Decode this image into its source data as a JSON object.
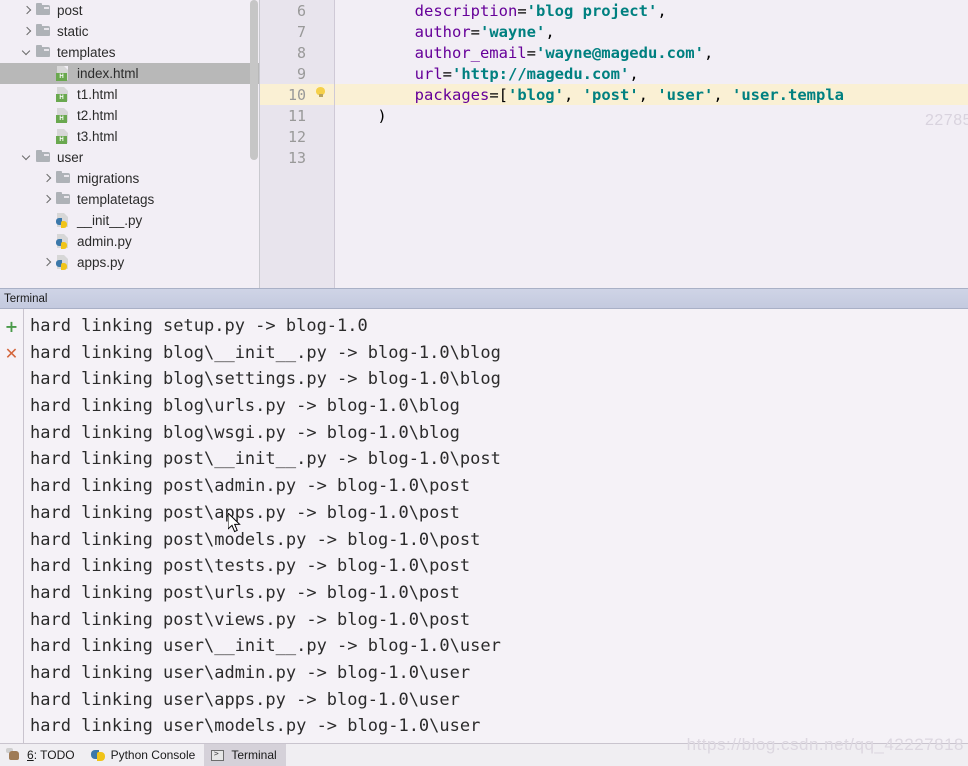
{
  "project_tree": {
    "items": [
      {
        "label": "post",
        "icon": "folder-icon",
        "indent": 1,
        "arrow": "right",
        "selected": false
      },
      {
        "label": "static",
        "icon": "folder-icon",
        "indent": 1,
        "arrow": "right",
        "selected": false
      },
      {
        "label": "templates",
        "icon": "folder-icon",
        "indent": 1,
        "arrow": "down",
        "selected": false
      },
      {
        "label": "index.html",
        "icon": "html-file-icon",
        "indent": 2,
        "arrow": "none",
        "selected": true
      },
      {
        "label": "t1.html",
        "icon": "html-file-icon",
        "indent": 2,
        "arrow": "none",
        "selected": false
      },
      {
        "label": "t2.html",
        "icon": "html-file-icon",
        "indent": 2,
        "arrow": "none",
        "selected": false
      },
      {
        "label": "t3.html",
        "icon": "html-file-icon",
        "indent": 2,
        "arrow": "none",
        "selected": false
      },
      {
        "label": "user",
        "icon": "folder-icon",
        "indent": 1,
        "arrow": "down",
        "selected": false
      },
      {
        "label": "migrations",
        "icon": "folder-icon",
        "indent": 2,
        "arrow": "right",
        "selected": false
      },
      {
        "label": "templatetags",
        "icon": "folder-icon",
        "indent": 2,
        "arrow": "right",
        "selected": false
      },
      {
        "label": "__init__.py",
        "icon": "python-file-icon",
        "indent": 2,
        "arrow": "none",
        "selected": false
      },
      {
        "label": "admin.py",
        "icon": "python-file-icon",
        "indent": 2,
        "arrow": "none",
        "selected": false
      },
      {
        "label": "apps.py",
        "icon": "python-file-icon",
        "indent": 2,
        "arrow": "right",
        "selected": false
      }
    ]
  },
  "editor": {
    "lines": [
      {
        "number": "6",
        "bulb": false,
        "current": false,
        "tokens": [
          {
            "t": "plain",
            "v": "        "
          },
          {
            "t": "param",
            "v": "description"
          },
          {
            "t": "punct",
            "v": "="
          },
          {
            "t": "str",
            "v": "'blog project'"
          },
          {
            "t": "punct",
            "v": ","
          }
        ]
      },
      {
        "number": "7",
        "bulb": false,
        "current": false,
        "tokens": [
          {
            "t": "plain",
            "v": "        "
          },
          {
            "t": "param",
            "v": "author"
          },
          {
            "t": "punct",
            "v": "="
          },
          {
            "t": "str",
            "v": "'wayne'"
          },
          {
            "t": "punct",
            "v": ","
          }
        ]
      },
      {
        "number": "8",
        "bulb": false,
        "current": false,
        "tokens": [
          {
            "t": "plain",
            "v": "        "
          },
          {
            "t": "param",
            "v": "author_email"
          },
          {
            "t": "punct",
            "v": "="
          },
          {
            "t": "str",
            "v": "'wayne@magedu.com'"
          },
          {
            "t": "punct",
            "v": ","
          }
        ]
      },
      {
        "number": "9",
        "bulb": false,
        "current": false,
        "tokens": [
          {
            "t": "plain",
            "v": "        "
          },
          {
            "t": "param",
            "v": "url"
          },
          {
            "t": "punct",
            "v": "="
          },
          {
            "t": "str",
            "v": "'http://magedu.com'"
          },
          {
            "t": "punct",
            "v": ","
          }
        ]
      },
      {
        "number": "10",
        "bulb": true,
        "current": true,
        "tokens": [
          {
            "t": "plain",
            "v": "        "
          },
          {
            "t": "param",
            "v": "packages"
          },
          {
            "t": "punct",
            "v": "=["
          },
          {
            "t": "str",
            "v": "'blog'"
          },
          {
            "t": "punct",
            "v": ", "
          },
          {
            "t": "str",
            "v": "'post'"
          },
          {
            "t": "punct",
            "v": ", "
          },
          {
            "t": "str",
            "v": "'user'"
          },
          {
            "t": "punct",
            "v": ", "
          },
          {
            "t": "str",
            "v": "'user.templa"
          }
        ]
      },
      {
        "number": "11",
        "bulb": false,
        "current": false,
        "tokens": [
          {
            "t": "punct",
            "v": "    )"
          }
        ]
      },
      {
        "number": "12",
        "bulb": false,
        "current": false,
        "tokens": []
      },
      {
        "number": "13",
        "bulb": false,
        "current": false,
        "tokens": []
      }
    ],
    "watermark": "22785"
  },
  "terminal": {
    "header_title": "Terminal",
    "gutter_icons": [
      {
        "name": "add-icon",
        "glyph": "+"
      },
      {
        "name": "close-icon",
        "glyph": "✕"
      }
    ],
    "lines": [
      "hard linking setup.py -> blog-1.0",
      "hard linking blog\\__init__.py -> blog-1.0\\blog",
      "hard linking blog\\settings.py -> blog-1.0\\blog",
      "hard linking blog\\urls.py -> blog-1.0\\blog",
      "hard linking blog\\wsgi.py -> blog-1.0\\blog",
      "hard linking post\\__init__.py -> blog-1.0\\post",
      "hard linking post\\admin.py -> blog-1.0\\post",
      "hard linking post\\apps.py -> blog-1.0\\post",
      "hard linking post\\models.py -> blog-1.0\\post",
      "hard linking post\\tests.py -> blog-1.0\\post",
      "hard linking post\\urls.py -> blog-1.0\\post",
      "hard linking post\\views.py -> blog-1.0\\post",
      "hard linking user\\__init__.py -> blog-1.0\\user",
      "hard linking user\\admin.py -> blog-1.0\\user",
      "hard linking user\\apps.py -> blog-1.0\\user",
      "hard linking user\\models.py -> blog-1.0\\user"
    ]
  },
  "status_bar": {
    "items": [
      {
        "label": "6: TODO",
        "underline_first": true,
        "icon": "todo-icon",
        "active": false
      },
      {
        "label": "Python Console",
        "underline_first": false,
        "icon": "python-icon",
        "active": false
      },
      {
        "label": "Terminal",
        "underline_first": false,
        "icon": "terminal-box-icon",
        "active": true
      }
    ]
  },
  "watermark": "https://blog.csdn.net/qq_42227818",
  "colors": {
    "editor_bg": "#f2eef5",
    "gutter_bg": "#e8e4ed",
    "current_line": "#faf0d4",
    "string": "#008080",
    "param": "#660099",
    "selection": "#b8b8b8",
    "terminal_header": "#c8cee0",
    "plus_icon": "#4a9a4a",
    "cross_icon": "#d4663c"
  }
}
